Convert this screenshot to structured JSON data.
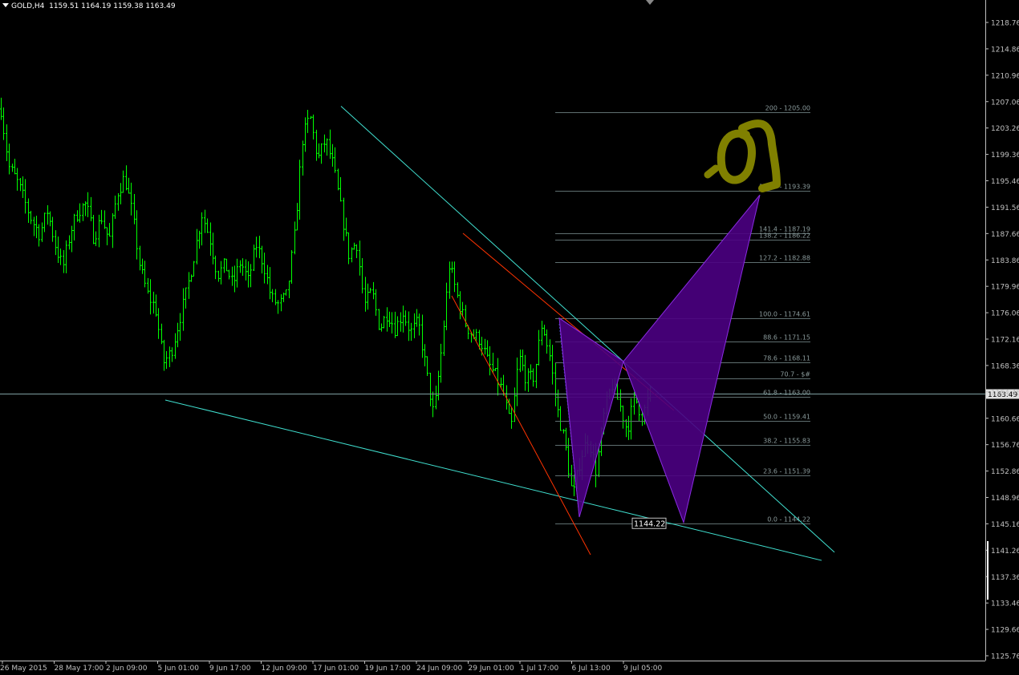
{
  "header": {
    "symbol": "GOLD,H4",
    "ohlc": "1159.51 1164.19 1159.38 1163.49"
  },
  "colors": {
    "background": "#000000",
    "axis": "#c0c0c0",
    "candles": "#00ff00",
    "trend": "#40e0d0",
    "red_line": "#ff3300",
    "pattern_fill": "#4b0082",
    "pattern_stroke": "#8a2be2",
    "fib_line": "#5f6f70",
    "fib_text": "#8a9a9b",
    "bid_line": "#7f9fa0",
    "drawing": "#808000"
  },
  "chart_data": {
    "type": "candlestick",
    "symbol": "GOLD",
    "timeframe": "H4",
    "ylim": [
      1124.0,
      1221.6
    ],
    "y_ticks": [
      "1218.76",
      "1214.86",
      "1210.96",
      "1207.06",
      "1203.26",
      "1199.36",
      "1195.46",
      "1191.56",
      "1187.66",
      "1183.86",
      "1179.96",
      "1176.06",
      "1172.16",
      "1168.36",
      "1164.46",
      "1160.66",
      "1156.76",
      "1152.86",
      "1148.96",
      "1145.16",
      "1141.26",
      "1137.36",
      "1133.46",
      "1129.66",
      "1125.76"
    ],
    "x_ticks": [
      "26 May 2015",
      "28 May 17:00",
      "2 Jun 09:00",
      "5 Jun 01:00",
      "9 Jun 17:00",
      "12 Jun 09:00",
      "17 Jun 01:00",
      "19 Jun 17:00",
      "24 Jun 09:00",
      "29 Jun 01:00",
      "1 Jul 17:00",
      "6 Jul 13:00",
      "9 Jul 05:00"
    ],
    "current_price": "1163.49",
    "fib_levels": [
      {
        "label": "200 - 1205.00",
        "value": 1205.0
      },
      {
        "label": "161.8 - 1193.39",
        "value": 1193.39
      },
      {
        "label": "141.4 - 1187.19",
        "value": 1187.19
      },
      {
        "label": "138.2 - 1186.22",
        "value": 1186.22
      },
      {
        "label": "127.2 - 1182.88",
        "value": 1182.88
      },
      {
        "label": "100.0 - 1174.61",
        "value": 1174.61
      },
      {
        "label": "88.6 - 1171.15",
        "value": 1171.15
      },
      {
        "label": "78.6 - 1168.11",
        "value": 1168.11
      },
      {
        "label": "70.7 - $#",
        "value": 1165.7
      },
      {
        "label": "61.8 - 1163.00",
        "value": 1163.0
      },
      {
        "label": "50.0 - 1159.41",
        "value": 1159.41
      },
      {
        "label": "38.2 - 1155.83",
        "value": 1155.83
      },
      {
        "label": "23.6 - 1151.39",
        "value": 1151.39
      },
      {
        "label": "0.0 - 1144.22",
        "value": 1144.22
      }
    ],
    "price_label": "1144.22",
    "pattern_points_price": {
      "X": 1174.6,
      "A": 1168.2,
      "B": 1144.4,
      "C": 1192.8
    },
    "trend_lines": [
      {
        "name": "upper",
        "from_price": 1205.9,
        "to_price": 1140.0
      },
      {
        "name": "lower",
        "from_price": 1162.5,
        "to_price": 1138.8
      }
    ],
    "price_path": [
      1205.5,
      1197.0,
      1195.0,
      1192.0,
      1189.0,
      1187.0,
      1190.5,
      1185.5,
      1182.0,
      1187.5,
      1190.5,
      1191.5,
      1186.5,
      1189.5,
      1186.0,
      1193.0,
      1195.5,
      1190.0,
      1182.0,
      1178.0,
      1176.0,
      1168.0,
      1169.5,
      1174.0,
      1178.5,
      1184.0,
      1190.0,
      1186.5,
      1181.0,
      1182.5,
      1179.5,
      1183.0,
      1180.0,
      1185.5,
      1182.5,
      1177.5,
      1176.5,
      1178.0,
      1187.0,
      1201.0,
      1204.5,
      1198.0,
      1201.0,
      1197.0,
      1190.5,
      1184.0,
      1186.0,
      1176.5,
      1178.5,
      1173.0,
      1175.5,
      1173.0,
      1175.5,
      1172.5,
      1174.0,
      1167.0,
      1160.0,
      1170.0,
      1182.5,
      1178.0,
      1174.0,
      1172.0,
      1171.5,
      1168.0,
      1166.0,
      1163.5,
      1158.0,
      1169.0,
      1165.5,
      1166.0,
      1174.0,
      1169.0,
      1161.0,
      1156.0,
      1148.0,
      1154.0,
      1157.0,
      1152.0,
      1160.0,
      1165.0,
      1162.0,
      1158.0,
      1163.0,
      1160.0,
      1163.49
    ]
  }
}
